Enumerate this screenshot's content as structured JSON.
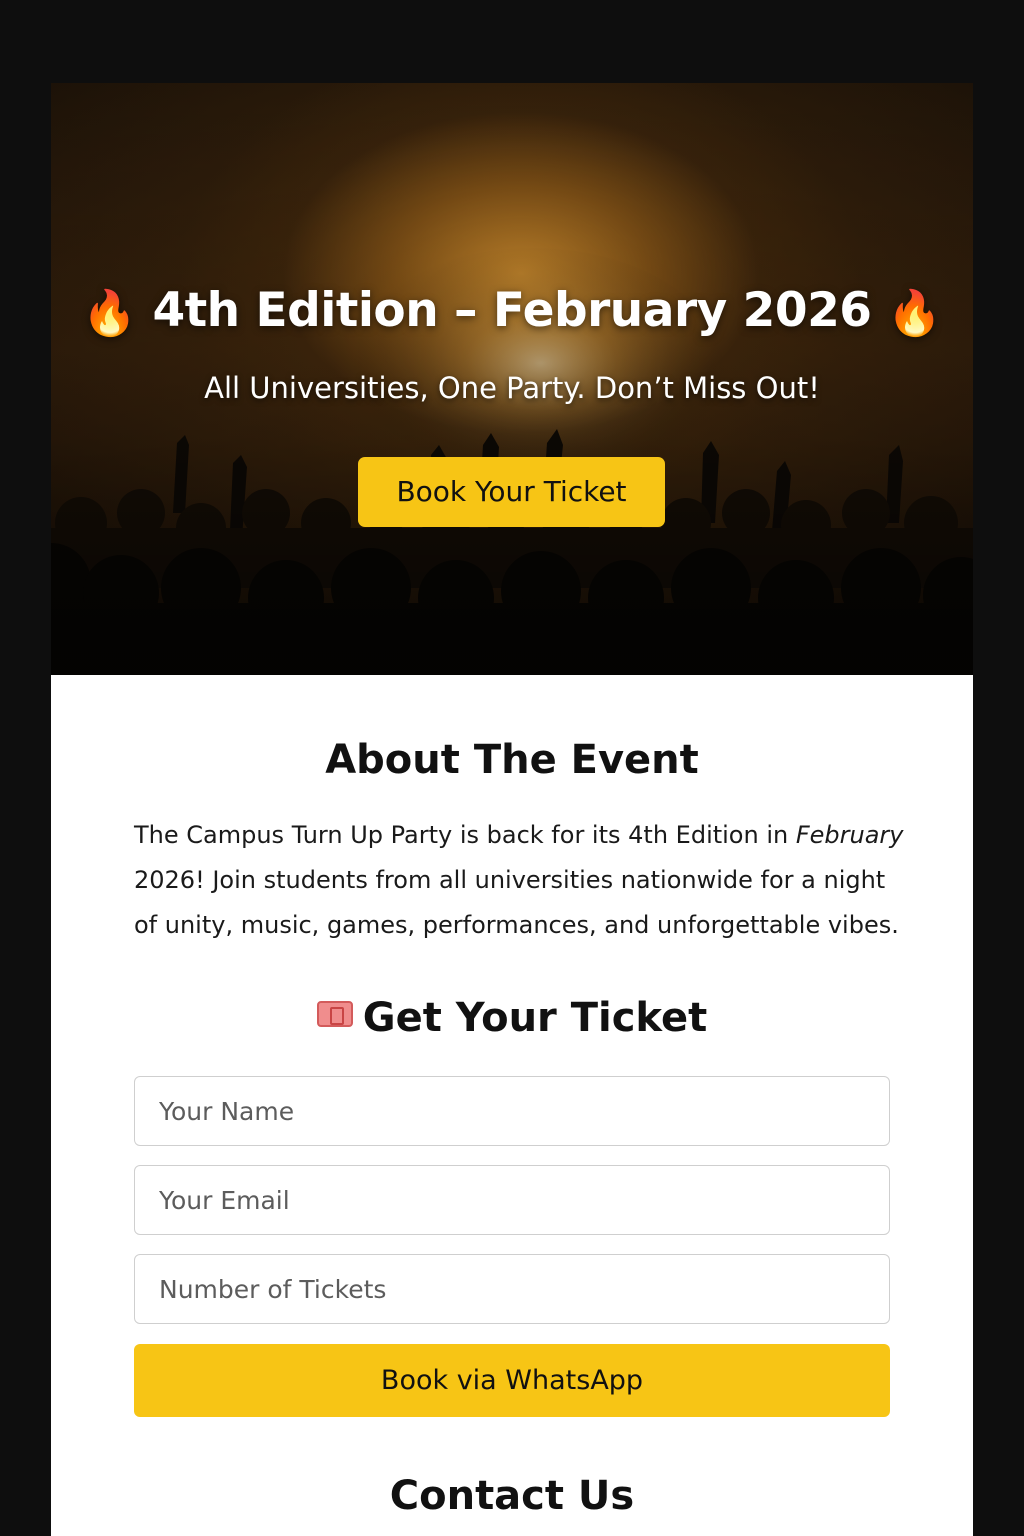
{
  "hero": {
    "fire_left": "🔥",
    "title": "4th Edition – February 2026",
    "fire_right": "🔥",
    "subtitle": "All Universities, One Party. Don’t Miss Out!",
    "cta_label": "Book Your Ticket",
    "background": "concert-crowd-image",
    "accent_color": "#f7c515"
  },
  "about": {
    "title": "About The Event",
    "text_before": "The Campus Turn Up Party is back for its 4th Edition in ",
    "text_emphasis": "February",
    "text_after": " 2026! Join students from all universities nationwide for a night of unity, music, games, performances, and unforgettable vibes."
  },
  "ticket_form": {
    "icon": "ticket-icon",
    "title": "Get Your Ticket",
    "name_placeholder": "Your Name",
    "email_placeholder": "Your Email",
    "tickets_placeholder": "Number of Tickets",
    "submit_label": "Book via WhatsApp"
  },
  "contact": {
    "title": "Contact Us"
  }
}
